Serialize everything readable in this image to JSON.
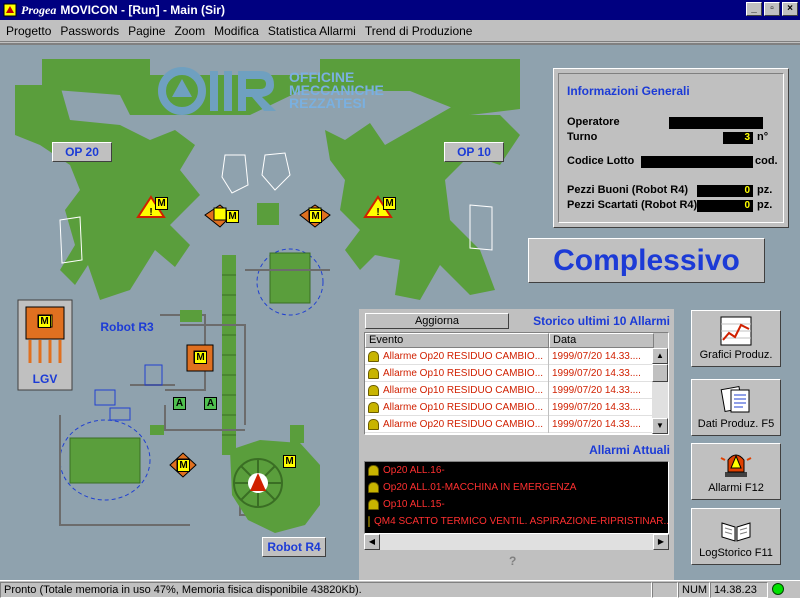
{
  "window": {
    "brand": "Progea",
    "title": "MOVICON - [Run] - Main (Sir)",
    "controls": {
      "minimize": "_",
      "maximize": "▫",
      "close": "×"
    }
  },
  "menu": [
    "Progetto",
    "Passwords",
    "Pagine",
    "Zoom",
    "Modifica",
    "Statistica Allarmi",
    "Trend di Produzione"
  ],
  "menu_accel": [
    "P",
    "a",
    "P",
    "Z",
    "M",
    "S",
    "T"
  ],
  "logo": {
    "letters": "OMR",
    "line1": "OFFICINE",
    "line2": "MECCANICHE",
    "line3": "REZZATESI"
  },
  "plant": {
    "op20": "OP 20",
    "op10": "OP 10",
    "robot_r3": "Robot R3",
    "robot_r4": "Robot R4",
    "lgv": "LGV",
    "m": "M",
    "a": "A"
  },
  "info": {
    "title": "Informazioni Generali",
    "operatore": {
      "label": "Operatore",
      "value": ""
    },
    "turno": {
      "label": "Turno",
      "value": "3",
      "unit": "n°"
    },
    "codice_lotto": {
      "label": "Codice Lotto",
      "value": "",
      "unit": "cod."
    },
    "pezzi_buoni": {
      "label": "Pezzi Buoni (Robot R4)",
      "value": "0",
      "unit": "pz."
    },
    "pezzi_scartati": {
      "label": "Pezzi Scartati (Robot R4)",
      "value": "0",
      "unit": "pz."
    }
  },
  "complessivo": "Complessivo",
  "storico": {
    "button": "Aggiorna",
    "title": "Storico ultimi 10 Allarmi",
    "columns": [
      "Evento",
      "Data"
    ],
    "rows": [
      {
        "evento": "Allarme Op20 RESIDUO CAMBIO...",
        "data": "1999/07/20 14.33...."
      },
      {
        "evento": "Allarme Op10 RESIDUO CAMBIO...",
        "data": "1999/07/20 14.33...."
      },
      {
        "evento": "Allarme Op10 RESIDUO CAMBIO...",
        "data": "1999/07/20 14.33...."
      },
      {
        "evento": "Allarme Op10 RESIDUO CAMBIO...",
        "data": "1999/07/20 14.33...."
      },
      {
        "evento": "Allarme Op20 RESIDUO CAMBIO...",
        "data": "1999/07/20 14.33...."
      }
    ]
  },
  "attuali": {
    "title": "Allarmi Attuali",
    "rows": [
      "Op20 ALL.16-",
      "Op20 ALL.01-MACCHINA IN EMERGENZA",
      "Op10 ALL.15-",
      "QM4 SCATTO TERMICO VENTIL. ASPIRAZIONE-RIPRISTINAR..."
    ],
    "help": "?"
  },
  "side_buttons": {
    "grafici": "Grafici Produz.",
    "dati": "Dati Produz. F5",
    "allarmi": "Allarmi F12",
    "logstorico": "LogStorico F11"
  },
  "status": {
    "message": "Pronto (Totale memoria in uso 47%, Memoria fisica disponibile 43820Kb).",
    "num": "NUM",
    "time": "14.38.23"
  },
  "colors": {
    "machine_green": "#5a9e3c",
    "background": "#8fa2ae",
    "accent_blue": "#1c3bd6",
    "alarm_red": "#d02000"
  }
}
